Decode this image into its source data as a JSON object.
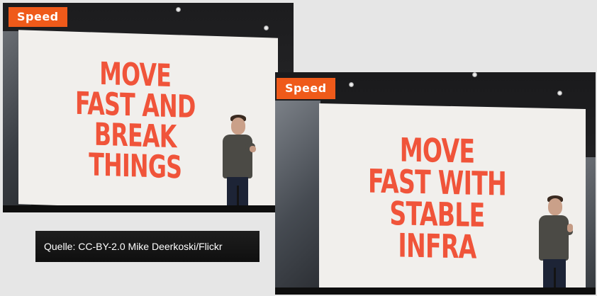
{
  "photos": [
    {
      "tag": "Speed",
      "slogan_lines": [
        "MOVE",
        "FAST AND",
        "BREAK",
        "THINGS"
      ]
    },
    {
      "tag": "Speed",
      "slogan_lines": [
        "MOVE",
        "FAST WITH",
        "STABLE",
        "INFRA"
      ]
    }
  ],
  "credit": {
    "text": "Quelle:  CC-BY-2.0 Mike Deerkoski/Flickr"
  },
  "colors": {
    "tag_background": "#ef5a1a",
    "slogan_text": "#f0543a",
    "screen": "#f1efec",
    "page_background": "#e6e6e6"
  }
}
